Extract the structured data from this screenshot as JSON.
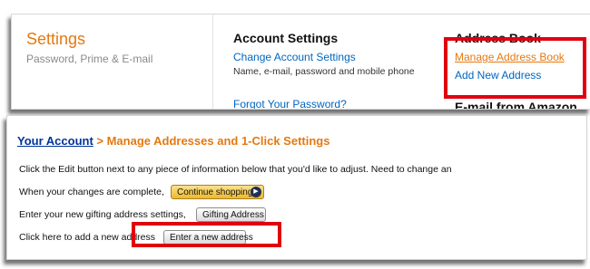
{
  "settings_panel": {
    "title": "Settings",
    "subtitle": "Password, Prime & E-mail",
    "account_settings": {
      "heading": "Account Settings",
      "change_link": "Change Account Settings",
      "change_note": "Name, e-mail, password and mobile phone",
      "forgot_link": "Forgot Your Password?"
    },
    "address_book": {
      "heading": "Address Book",
      "manage_link": "Manage Address Book",
      "add_link": "Add New Address"
    },
    "email_heading": "E-mail from Amazon"
  },
  "address_page": {
    "breadcrumb_link": "Your Account",
    "breadcrumb_rest": " > Manage Addresses and 1-Click Settings",
    "instructions": "Click the Edit button next to any piece of information below that you'd like to adjust. Need to change an",
    "complete_text": "When your changes are complete,",
    "continue_button": "Continue shopping",
    "gifting_text": "Enter your new gifting address settings,",
    "gifting_button": "Gifting Address",
    "new_address_text": "Click here to add a new address",
    "new_address_button": "Enter a new address"
  },
  "colors": {
    "highlight": "#e1000f",
    "accent_orange": "#e47911",
    "link_blue": "#0066c0"
  },
  "icons": {
    "continue_arrow": "arrow-circle-right-icon"
  }
}
